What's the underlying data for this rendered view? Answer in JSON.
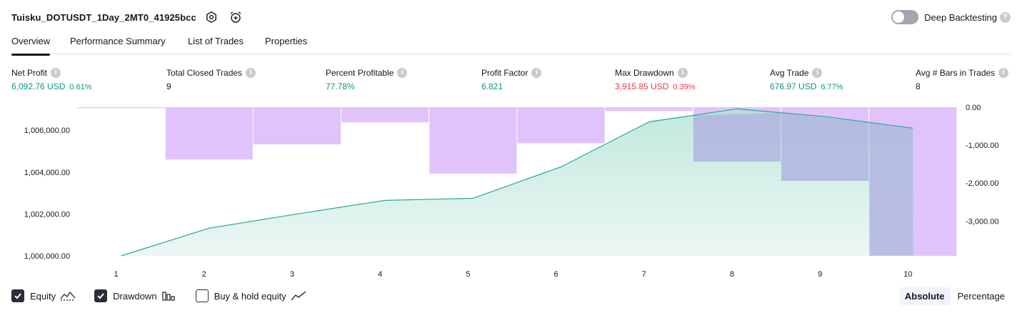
{
  "header": {
    "strategy_name": "Tuisku_DOTUSDT_1Day_2MT0_41925bcc",
    "settings_icon": "settings-gear-icon",
    "alert_icon": "alarm-clock-plus-icon",
    "deep_backtesting_label": "Deep Backtesting",
    "deep_backtesting_enabled": false,
    "help_glyph": "?"
  },
  "tabs": [
    {
      "label": "Overview",
      "active": true
    },
    {
      "label": "Performance Summary",
      "active": false
    },
    {
      "label": "List of Trades",
      "active": false
    },
    {
      "label": "Properties",
      "active": false
    }
  ],
  "stats": [
    {
      "label": "Net Profit",
      "value": "6,092.76 USD",
      "pct": "0.61%",
      "tone": "pos"
    },
    {
      "label": "Total Closed Trades",
      "value": "9",
      "pct": "",
      "tone": "neu"
    },
    {
      "label": "Percent Profitable",
      "value": "77.78%",
      "pct": "",
      "tone": "pos"
    },
    {
      "label": "Profit Factor",
      "value": "6.821",
      "pct": "",
      "tone": "pos"
    },
    {
      "label": "Max Drawdown",
      "value": "3,915.85 USD",
      "pct": "0.39%",
      "tone": "neg"
    },
    {
      "label": "Avg Trade",
      "value": "676.97 USD",
      "pct": "6.77%",
      "tone": "pos"
    },
    {
      "label": "Avg # Bars in Trades",
      "value": "8",
      "pct": "",
      "tone": "neu"
    }
  ],
  "stat_info_glyph": "i",
  "colors": {
    "positive": "#089981",
    "negative": "#f23645",
    "equity_line": "#26a69a",
    "drawdown_bar": "#e1c3fc",
    "overlap_bar": "#b1b6e0"
  },
  "chart_data": {
    "type": "area",
    "x": [
      1,
      2,
      3,
      4,
      5,
      6,
      7,
      8,
      9,
      10
    ],
    "series": [
      {
        "name": "Equity",
        "axis": "left",
        "values": [
          1000000,
          1001320,
          1002000,
          1002650,
          1002750,
          1004250,
          1006400,
          1007020,
          1006650,
          1006100
        ]
      },
      {
        "name": "Drawdown",
        "axis": "right",
        "type": "bar",
        "values": [
          0,
          -1380,
          -980,
          -400,
          -1750,
          -950,
          -100,
          -1430,
          -1940,
          -3915.85
        ]
      }
    ],
    "y_left_ticks": [
      "1,000,000.00",
      "1,002,000.00",
      "1,004,000.00",
      "1,006,000.00"
    ],
    "y_right_ticks": [
      "0.00",
      "-1,000.00",
      "-2,000.00",
      "-3,000.00"
    ],
    "ylim_left": [
      1000000,
      1007100
    ],
    "ylim_right": [
      -3915.85,
      0
    ],
    "legend": "bottom-left"
  },
  "legend_items": [
    {
      "label": "Equity",
      "checked": true,
      "icon": "equity-line-icon"
    },
    {
      "label": "Drawdown",
      "checked": true,
      "icon": "drawdown-bars-icon"
    },
    {
      "label": "Buy & hold equity",
      "checked": false,
      "icon": "buy-hold-line-icon"
    }
  ],
  "modes": [
    {
      "label": "Absolute",
      "active": true
    },
    {
      "label": "Percentage",
      "active": false
    }
  ]
}
